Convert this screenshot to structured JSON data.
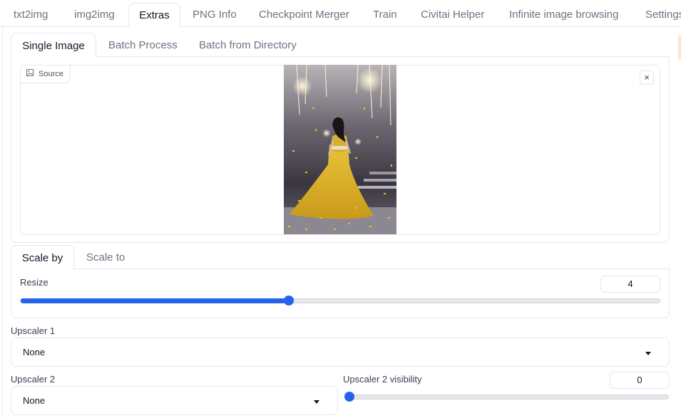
{
  "top_tabs": [
    "txt2img",
    "img2img",
    "Extras",
    "PNG Info",
    "Checkpoint Merger",
    "Train",
    "Civitai Helper",
    "Infinite image browsing",
    "Settings"
  ],
  "sub_tabs": [
    "Single Image",
    "Batch Process",
    "Batch from Directory"
  ],
  "source": {
    "label": "Source",
    "close": "×"
  },
  "scale_tabs": [
    "Scale by",
    "Scale to"
  ],
  "resize": {
    "label": "Resize",
    "value": "4",
    "fraction": 0.42
  },
  "upscaler1": {
    "label": "Upscaler 1",
    "value": "None"
  },
  "upscaler2": {
    "label": "Upscaler 2",
    "value": "None"
  },
  "upscaler2_visibility": {
    "label": "Upscaler 2 visibility",
    "value": "0",
    "fraction": 0.0
  },
  "colors": {
    "accent": "#2563eb",
    "border": "#e5e7eb"
  }
}
